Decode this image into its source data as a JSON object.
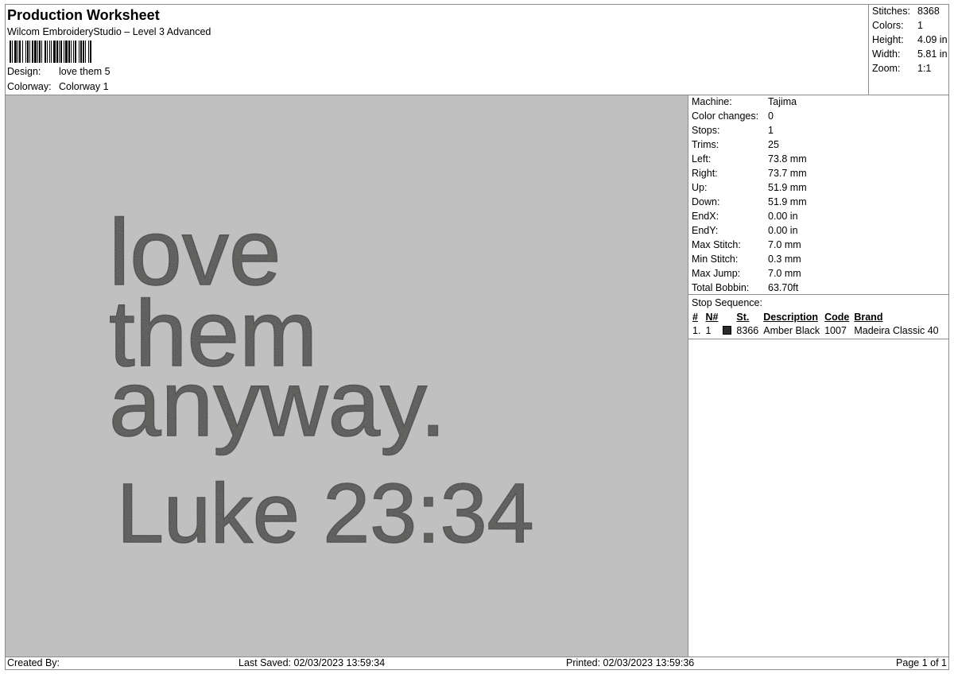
{
  "header": {
    "title": "Production Worksheet",
    "subtitle": "Wilcom EmbroideryStudio – Level 3 Advanced",
    "design_label": "Design:",
    "design_value": "love them 5",
    "colorway_label": "Colorway:",
    "colorway_value": "Colorway 1"
  },
  "summary": [
    {
      "label": "Stitches:",
      "value": "8368"
    },
    {
      "label": "Colors:",
      "value": "1"
    },
    {
      "label": "Height:",
      "value": "4.09 in"
    },
    {
      "label": "Width:",
      "value": "5.81 in"
    },
    {
      "label": "Zoom:",
      "value": "1:1"
    }
  ],
  "design": {
    "lines": [
      "love",
      "them",
      "anyway.",
      "Luke 23:34"
    ],
    "thread_color": "#3a3b38",
    "background_color": "#c0c0c0"
  },
  "machine": [
    {
      "label": "Machine:",
      "value": "Tajima"
    },
    {
      "label": "Color changes:",
      "value": "0"
    },
    {
      "label": "Stops:",
      "value": "1"
    },
    {
      "label": "Trims:",
      "value": "25"
    },
    {
      "label": "Left:",
      "value": "73.8 mm"
    },
    {
      "label": "Right:",
      "value": "73.7 mm"
    },
    {
      "label": "Up:",
      "value": "51.9 mm"
    },
    {
      "label": "Down:",
      "value": "51.9 mm"
    },
    {
      "label": "EndX:",
      "value": "0.00 in"
    },
    {
      "label": "EndY:",
      "value": "0.00 in"
    },
    {
      "label": "Max Stitch:",
      "value": "7.0 mm"
    },
    {
      "label": "Min Stitch:",
      "value": "0.3 mm"
    },
    {
      "label": "Max Jump:",
      "value": "7.0 mm"
    },
    {
      "label": "Total Bobbin:",
      "value": "63.70ft"
    }
  ],
  "stop_sequence": {
    "heading": "Stop Sequence:",
    "columns": [
      "#",
      "N#",
      "",
      "St.",
      "Description",
      "Code",
      "Brand"
    ],
    "rows": [
      {
        "index": "1.",
        "n": "1",
        "swatch_color": "#2b2b2b",
        "stitches": "8366",
        "description": "Amber Black",
        "code": "1007",
        "brand": "Madeira Classic 40"
      }
    ]
  },
  "footer": {
    "created_by": "Created By:",
    "last_saved": "Last Saved: 02/03/2023 13:59:34",
    "printed": "Printed: 02/03/2023 13:59:36",
    "page": "Page 1 of 1"
  }
}
